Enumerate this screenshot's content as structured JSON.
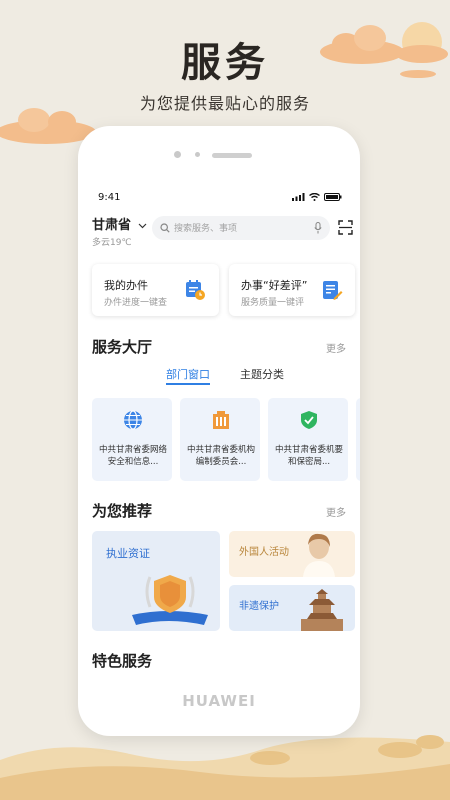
{
  "poster": {
    "title": "服务",
    "subtitle": "为您提供最贴心的服务"
  },
  "phone": {
    "brand": "HUAWEI",
    "status_bar": {
      "time": "9:41"
    },
    "header": {
      "location": "甘肃省",
      "weather": "多云19℃",
      "search_placeholder": "搜索服务、事项"
    },
    "quick_cards": [
      {
        "title": "我的办件",
        "subtitle": "办件进度一键查",
        "icon": "calendar-clock-icon"
      },
      {
        "title": "办事“好差评”",
        "subtitle": "服务质量一键评",
        "icon": "document-edit-icon"
      }
    ],
    "service_hall": {
      "title": "服务大厅",
      "more": "更多",
      "tabs": [
        {
          "label": "部门窗口",
          "active": true
        },
        {
          "label": "主题分类",
          "active": false
        }
      ],
      "items": [
        {
          "name": "中共甘肃省委网络安全和信息...",
          "icon": "network-globe-icon",
          "color": "#3d85e6"
        },
        {
          "name": "中共甘肃省委机构编制委员会...",
          "icon": "building-icon",
          "color": "#f0993a"
        },
        {
          "name": "中共甘肃省委机要和保密局...",
          "icon": "shield-check-icon",
          "color": "#2fb560"
        }
      ]
    },
    "recommend": {
      "title": "为您推荐",
      "more": "更多",
      "items": [
        {
          "label": "执业资证",
          "color": "#2f6fd0"
        },
        {
          "label": "外国人活动",
          "color": "#b8853a"
        },
        {
          "label": "非遗保护",
          "color": "#2f6fd0"
        }
      ]
    },
    "special": {
      "title": "特色服务"
    }
  },
  "colors": {
    "background": "#efebe2",
    "accent": "#2f7fe3",
    "cloud": "#f2bc8a"
  }
}
